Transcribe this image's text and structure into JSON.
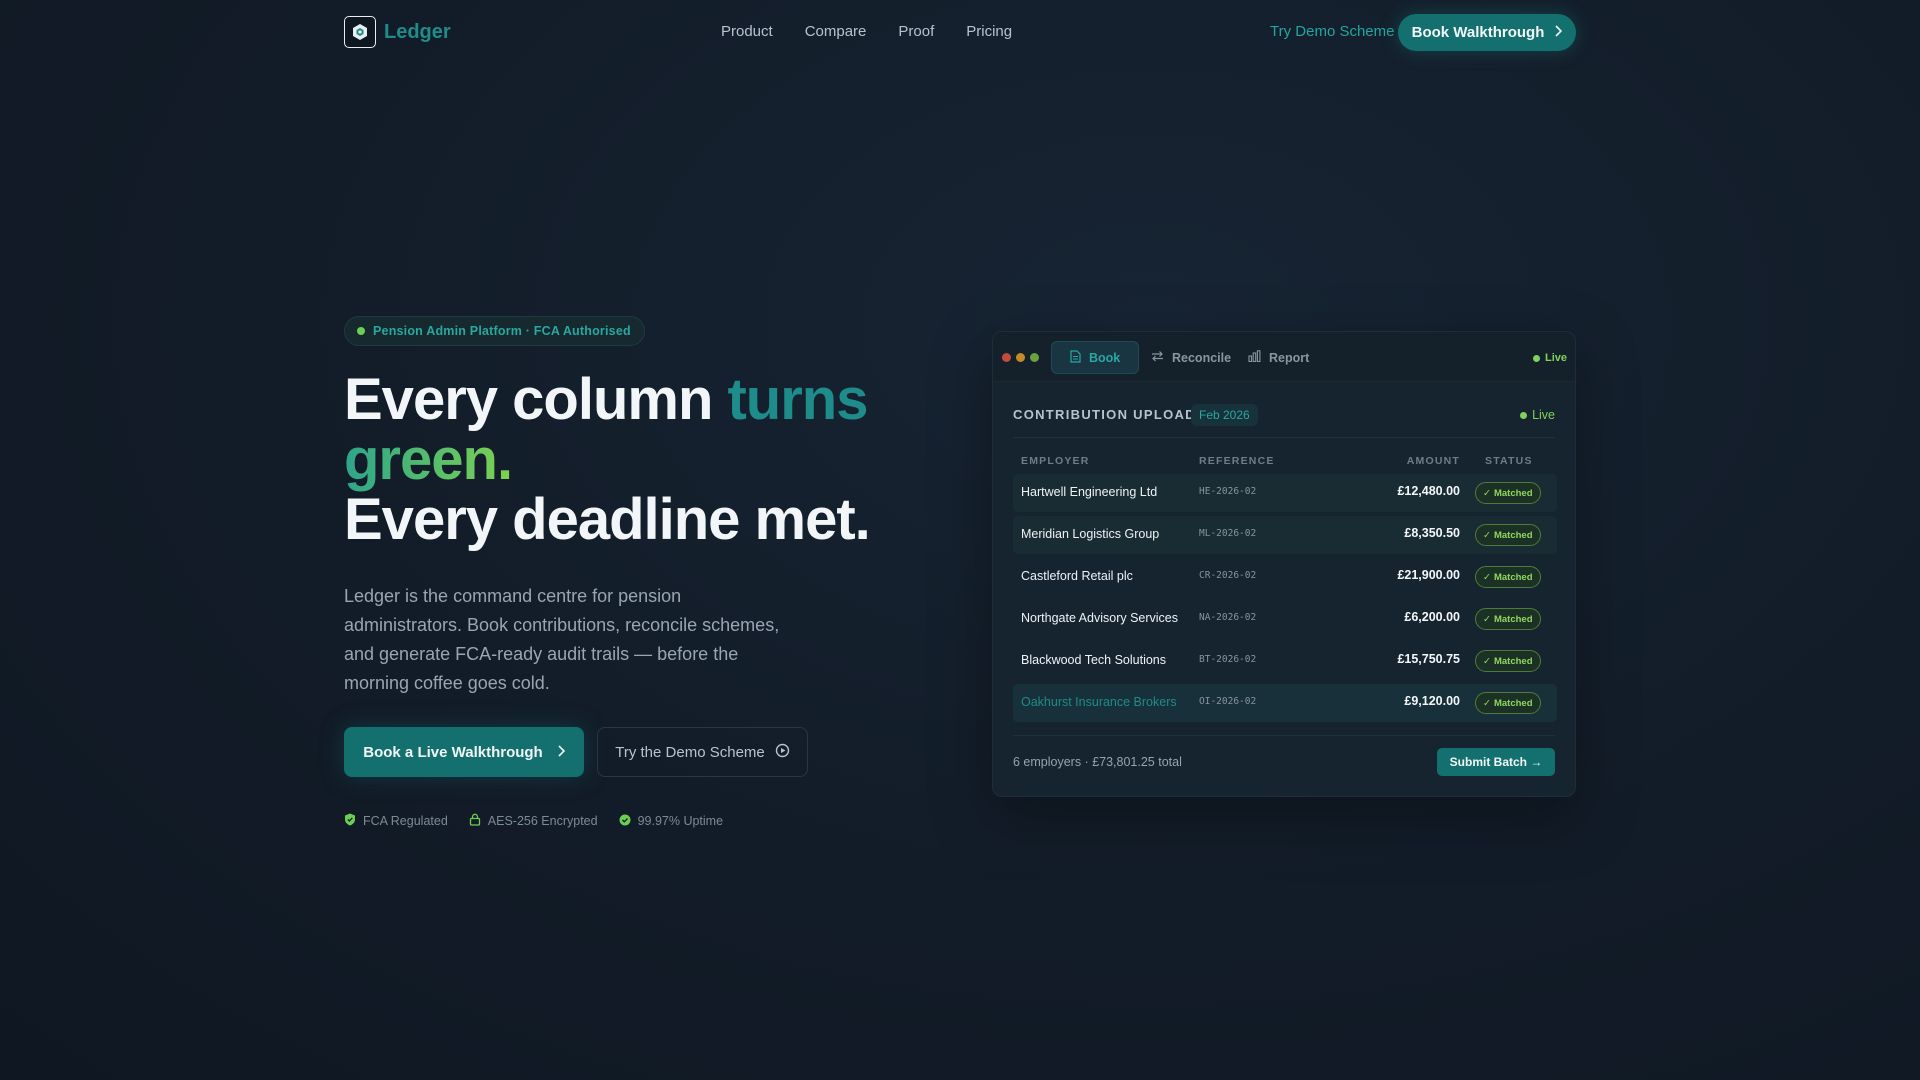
{
  "nav": {
    "logo_text": "Ledger",
    "links": [
      "Product",
      "Compare",
      "Proof",
      "Pricing"
    ],
    "demo_link": "Try Demo Scheme",
    "cta_label": "Book Walkthrough"
  },
  "hero": {
    "pill_text": "Pension Admin Platform · FCA Authorised",
    "headline_a": "Every column ",
    "headline_b": "turns",
    "headline_c": "green.",
    "headline_d": "Every deadline met.",
    "subtitle": "Ledger is the command centre for pension administrators. Book contributions, reconcile schemes, and generate FCA-ready audit trails — before the morning coffee goes cold.",
    "primary_button": "Book a Live Walkthrough",
    "secondary_button": "Try the Demo Scheme",
    "trust": [
      "FCA Regulated",
      "AES-256 Encrypted",
      "99.97% Uptime"
    ]
  },
  "app": {
    "tabs": [
      "Book",
      "Reconcile",
      "Report"
    ],
    "live_label": "Live",
    "section_title": "CONTRIBUTION UPLOAD",
    "period": "Feb 2026",
    "live_body": "Live",
    "columns": [
      "EMPLOYER",
      "REFERENCE",
      "AMOUNT",
      "STATUS"
    ],
    "rows": [
      {
        "employer": "Hartwell Engineering Ltd",
        "reference": "HE-2026-02",
        "amount": "£12,480.00",
        "status": "Matched"
      },
      {
        "employer": "Meridian Logistics Group",
        "reference": "ML-2026-02",
        "amount": "£8,350.50",
        "status": "Matched"
      },
      {
        "employer": "Castleford Retail plc",
        "reference": "CR-2026-02",
        "amount": "£21,900.00",
        "status": "Matched"
      },
      {
        "employer": "Northgate Advisory Services",
        "reference": "NA-2026-02",
        "amount": "£6,200.00",
        "status": "Matched"
      },
      {
        "employer": "Blackwood Tech Solutions",
        "reference": "BT-2026-02",
        "amount": "£15,750.75",
        "status": "Matched"
      },
      {
        "employer": "Oakhurst Insurance Brokers",
        "reference": "OI-2026-02",
        "amount": "£9,120.00",
        "status": "Matched"
      }
    ],
    "summary": "6 employers · £73,801.25 total",
    "submit_label": "Submit Batch →"
  },
  "colors": {
    "accent_teal": "#14706f",
    "accent_green": "#7fd35a",
    "background": "#121c28"
  }
}
